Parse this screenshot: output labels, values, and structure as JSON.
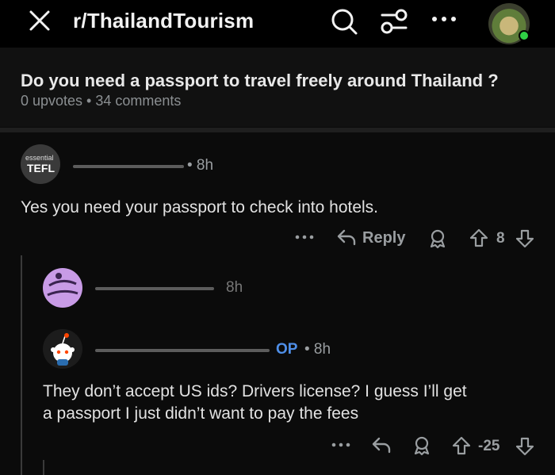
{
  "header": {
    "subreddit": "r/ThailandTourism"
  },
  "post": {
    "title": "Do you need a passport to travel freely around Thailand ?",
    "meta": "0 upvotes • 34 comments"
  },
  "comments": [
    {
      "avatar_text_small": "essential",
      "avatar_text_big": "TEFL",
      "time": "• 8h",
      "body": "Yes you need your passport to check into hotels.",
      "reply_label": "Reply",
      "score": "8"
    },
    {
      "time": "8h"
    },
    {
      "op_label": "OP",
      "time": "• 8h",
      "body_line1": "They don’t accept US ids? Drivers license? I guess I’ll get",
      "body_line2": "a passport I just didn’t want to pay the fees",
      "score": "-25"
    }
  ],
  "icons": [
    "close-icon",
    "search-icon",
    "filter-icon",
    "more-icon",
    "avatar",
    "reply-icon",
    "award-icon",
    "upvote-icon",
    "downvote-icon"
  ],
  "colors": {
    "background": "#0b0b0b",
    "op_blue": "#4f8fe8",
    "online_green": "#2fcf45"
  }
}
